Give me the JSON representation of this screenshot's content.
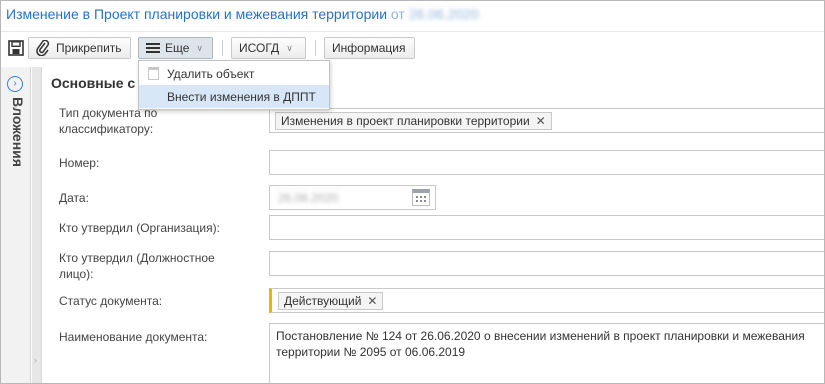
{
  "window": {
    "title": "Изменение в  Проект планировки и межевания территории",
    "title_date_prefix": "от",
    "title_date": "26.06.2020"
  },
  "toolbar": {
    "attach_label": "Прикрепить",
    "more_label": "Еще",
    "isogd_label": "ИСОГД",
    "info_label": "Информация"
  },
  "more_menu": {
    "items": [
      {
        "label": "Удалить объект"
      },
      {
        "label": "Внести изменения в ДППТ"
      }
    ]
  },
  "side_panel": {
    "label": "Вложения"
  },
  "section": {
    "title": "Основные с"
  },
  "form": {
    "doc_type_label": "Тип документа по классификатору:",
    "doc_type_value": "Изменения в проект планировки территории",
    "number_label": "Номер:",
    "number_value": "",
    "date_label": "Дата:",
    "date_value": "26.06.2020",
    "approved_org_label": "Кто утвердил (Организация):",
    "approved_org_value": "",
    "approved_position_label": "Кто утвердил (Должностное лицо):",
    "approved_position_value": "",
    "status_label": "Статус документа:",
    "status_value": "Действующий",
    "name_label": "Наименование документа:",
    "name_value": "Постановление № 124 от 26.06.2020 о внесении изменений в проект планировки и межевания территории № 2095 от 06.06.2019"
  },
  "colors": {
    "title_blue": "#2672c7",
    "menu_highlight": "#d8e7f7",
    "required_marker": "#f0b400"
  }
}
